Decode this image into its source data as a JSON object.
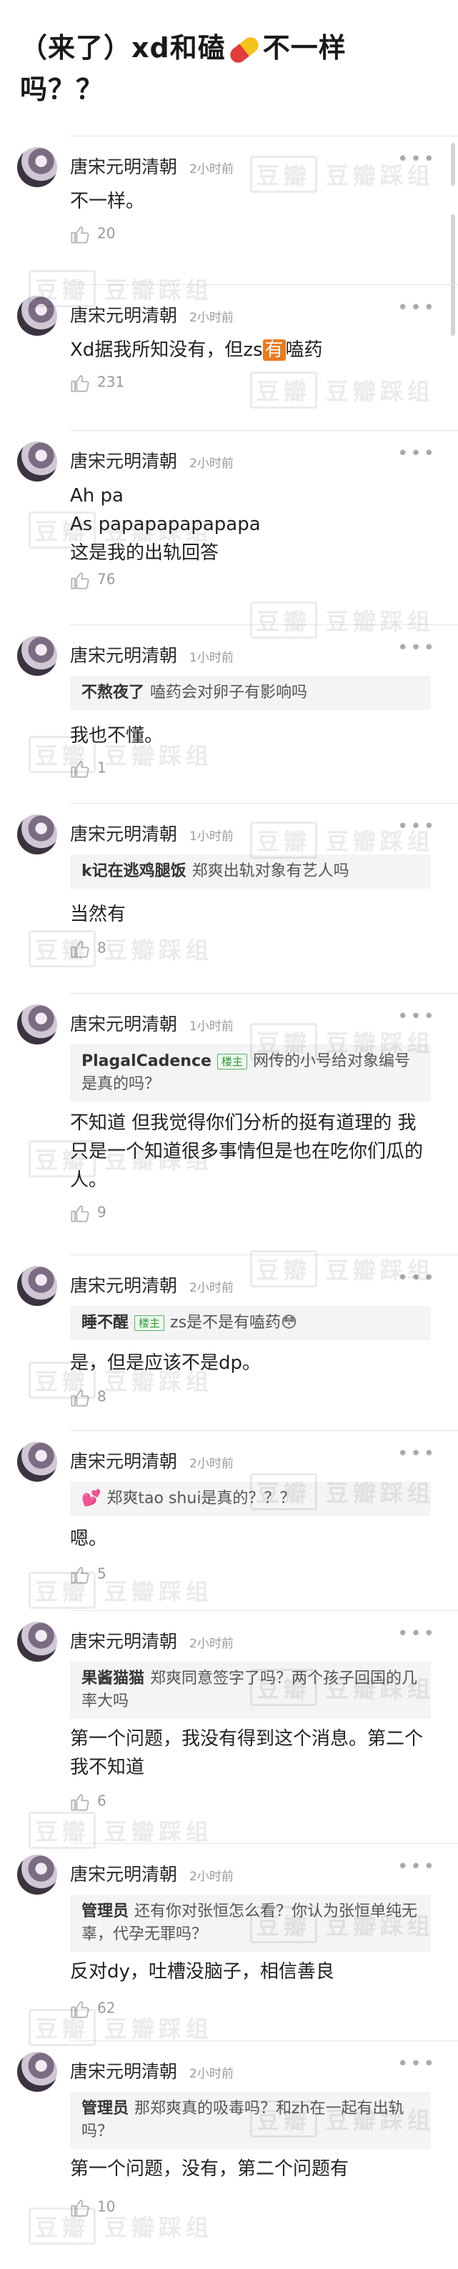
{
  "title": {
    "part1": "（来了）xd和磕",
    "pill_icon": "pill-emoji",
    "part2": "不一样吗？？"
  },
  "watermark": {
    "badge": "豆瓣",
    "text": "豆瓣踩组"
  },
  "comments": [
    {
      "author": "唐宋元明清朝",
      "time": "2小时前",
      "text": "不一样。",
      "likes": "20"
    },
    {
      "author": "唐宋元明清朝",
      "time": "2小时前",
      "text_a": "Xd据我所知没有，但zs",
      "text_hl": "有",
      "text_b": "嗑药",
      "likes": "231"
    },
    {
      "author": "唐宋元明清朝",
      "time": "2小时前",
      "text": "Ah pa\nAs papapapapapapa\n这是我的出轨回答",
      "likes": "76"
    },
    {
      "author": "唐宋元明清朝",
      "time": "1小时前",
      "quote_name": "不熬夜了",
      "quote_text": "嗑药会对卵子有影响吗",
      "text": "我也不懂。",
      "likes": "1"
    },
    {
      "author": "唐宋元明清朝",
      "time": "1小时前",
      "quote_name": "k记在逃鸡腿饭",
      "quote_text": "郑爽出轨对象有艺人吗",
      "text": "当然有",
      "likes": "8"
    },
    {
      "author": "唐宋元明清朝",
      "time": "1小时前",
      "quote_name": "PlagalCadence",
      "quote_badge": "楼主",
      "quote_text": "网传的小号给对象编号是真的吗？",
      "text": "不知道 但我觉得你们分析的挺有道理的 我只是一个知道很多事情但是也在吃你们瓜的人。",
      "likes": "9"
    },
    {
      "author": "唐宋元明清朝",
      "time": "2小时前",
      "quote_name": "睡不醒",
      "quote_badge": "楼主",
      "quote_text": "zs是不是有嗑药😳",
      "text": "是，但是应该不是dp。",
      "likes": "8"
    },
    {
      "author": "唐宋元明清朝",
      "time": "2小时前",
      "quote_name": "💕",
      "quote_text": "郑爽tao shui是真的？？？",
      "text": "嗯。",
      "likes": "5"
    },
    {
      "author": "唐宋元明清朝",
      "time": "2小时前",
      "quote_name": "果酱猫猫",
      "quote_text": "郑爽同意签字了吗？两个孩子回国的几率大吗",
      "text": "第一个问题，我没有得到这个消息。第二个我不知道",
      "likes": "6"
    },
    {
      "author": "唐宋元明清朝",
      "time": "2小时前",
      "quote_name": "管理员",
      "quote_text": "还有你对张恒怎么看？你认为张恒单纯无辜，代孕无罪吗？",
      "text": "反对dy，吐槽没脑子，相信善良",
      "likes": "62"
    },
    {
      "author": "唐宋元明清朝",
      "time": "2小时前",
      "quote_name": "管理员",
      "quote_text": "那郑爽真的吸毒吗？和zh在一起有出轨吗？",
      "text": "第一个问题，没有，第二个问题有",
      "likes": "10"
    }
  ],
  "more_icon": "•••"
}
